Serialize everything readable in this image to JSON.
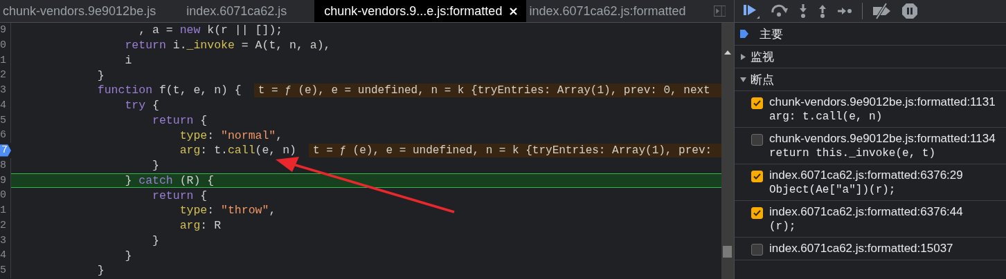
{
  "editor": {
    "tabs": [
      {
        "label": "chunk-vendors.9e9012be.js",
        "selected": false
      },
      {
        "label": "index.6071ca62.js",
        "selected": false
      },
      {
        "label": "chunk-vendors.9...e.js:formatted",
        "selected": true
      },
      {
        "label": "index.6071ca62.js:formatted",
        "selected": false
      }
    ],
    "lines": [
      {
        "number": "9",
        "breakpoint": false,
        "current": false,
        "tokens": [
          {
            "kind": "plain",
            "text": "                  , a = "
          },
          {
            "kind": "keyword",
            "text": "new"
          },
          {
            "kind": "plain",
            "text": " k(r || []);"
          }
        ]
      },
      {
        "number": "0",
        "breakpoint": false,
        "current": false,
        "tokens": [
          {
            "kind": "keyword",
            "text": "                return"
          },
          {
            "kind": "plain",
            "text": " i."
          },
          {
            "kind": "property",
            "text": "_invoke"
          },
          {
            "kind": "plain",
            "text": " = A(t, n, a),"
          }
        ]
      },
      {
        "number": "1",
        "breakpoint": false,
        "current": false,
        "tokens": [
          {
            "kind": "plain",
            "text": "                i"
          }
        ]
      },
      {
        "number": "2",
        "breakpoint": false,
        "current": false,
        "tokens": [
          {
            "kind": "plain",
            "text": "            }"
          }
        ]
      },
      {
        "number": "3",
        "breakpoint": false,
        "current": false,
        "tokens": [
          {
            "kind": "keyword",
            "text": "            function"
          },
          {
            "kind": "plain",
            "text": " f(t, e, n) {"
          }
        ],
        "inline_value": "t = ƒ (e), e = undefined, n = k {tryEntries: Array(1), prev: 0, next"
      },
      {
        "number": "4",
        "breakpoint": false,
        "current": false,
        "tokens": [
          {
            "kind": "keyword",
            "text": "                try"
          },
          {
            "kind": "plain",
            "text": " {"
          }
        ]
      },
      {
        "number": "5",
        "breakpoint": false,
        "current": false,
        "tokens": [
          {
            "kind": "keyword",
            "text": "                    return"
          },
          {
            "kind": "plain",
            "text": " {"
          }
        ]
      },
      {
        "number": "6",
        "breakpoint": false,
        "current": false,
        "tokens": [
          {
            "kind": "property",
            "text": "                        type"
          },
          {
            "kind": "plain",
            "text": ": "
          },
          {
            "kind": "string",
            "text": "\"normal\""
          },
          {
            "kind": "plain",
            "text": ","
          }
        ]
      },
      {
        "number": "7",
        "breakpoint": true,
        "current": false,
        "tokens": [
          {
            "kind": "property",
            "text": "                        arg"
          },
          {
            "kind": "plain",
            "text": ": t."
          },
          {
            "kind": "property",
            "text": "call"
          },
          {
            "kind": "plain",
            "text": "(e, n)"
          }
        ],
        "inline_value": "t = ƒ (e), e = undefined, n = k {tryEntries: Array(1), prev:"
      },
      {
        "number": "8",
        "breakpoint": false,
        "current": false,
        "tokens": [
          {
            "kind": "plain",
            "text": "                    }"
          }
        ]
      },
      {
        "number": "9",
        "breakpoint": false,
        "current": true,
        "tokens": [
          {
            "kind": "plain",
            "text": "                } "
          },
          {
            "kind": "keyword",
            "text": "catch"
          },
          {
            "kind": "plain",
            "text": " (R) {"
          }
        ]
      },
      {
        "number": "0",
        "breakpoint": false,
        "current": false,
        "tokens": [
          {
            "kind": "keyword",
            "text": "                    return"
          },
          {
            "kind": "plain",
            "text": " {"
          }
        ]
      },
      {
        "number": "1",
        "breakpoint": false,
        "current": false,
        "tokens": [
          {
            "kind": "property",
            "text": "                        type"
          },
          {
            "kind": "plain",
            "text": ": "
          },
          {
            "kind": "string",
            "text": "\"throw\""
          },
          {
            "kind": "plain",
            "text": ","
          }
        ]
      },
      {
        "number": "2",
        "breakpoint": false,
        "current": false,
        "tokens": [
          {
            "kind": "property",
            "text": "                        arg"
          },
          {
            "kind": "plain",
            "text": ": R"
          }
        ]
      },
      {
        "number": "3",
        "breakpoint": false,
        "current": false,
        "tokens": [
          {
            "kind": "plain",
            "text": "                    }"
          }
        ]
      },
      {
        "number": "4",
        "breakpoint": false,
        "current": false,
        "tokens": [
          {
            "kind": "plain",
            "text": "                }"
          }
        ]
      },
      {
        "number": "5",
        "breakpoint": false,
        "current": false,
        "tokens": [
          {
            "kind": "plain",
            "text": "            }"
          }
        ]
      }
    ]
  },
  "debugger": {
    "threads": [
      {
        "name": "主要",
        "current": true
      }
    ],
    "sections": [
      {
        "title": "监视",
        "expanded": false
      },
      {
        "title": "断点",
        "expanded": true
      }
    ],
    "breakpoints": [
      {
        "location": "chunk-vendors.9e9012be.js:formatted:1131",
        "code": "arg: t.call(e, n)",
        "checked": true
      },
      {
        "location": "chunk-vendors.9e9012be.js:formatted:1134",
        "code": "return this._invoke(e, t)",
        "checked": false
      },
      {
        "location": "index.6071ca62.js:formatted:6376:29",
        "code": "Object(Ae[\"a\"])(r);",
        "checked": true
      },
      {
        "location": "index.6071ca62.js:formatted:6376:44",
        "code": "(r);",
        "checked": true
      },
      {
        "location": "index.6071ca62.js:formatted:15037",
        "checked": false
      }
    ]
  }
}
